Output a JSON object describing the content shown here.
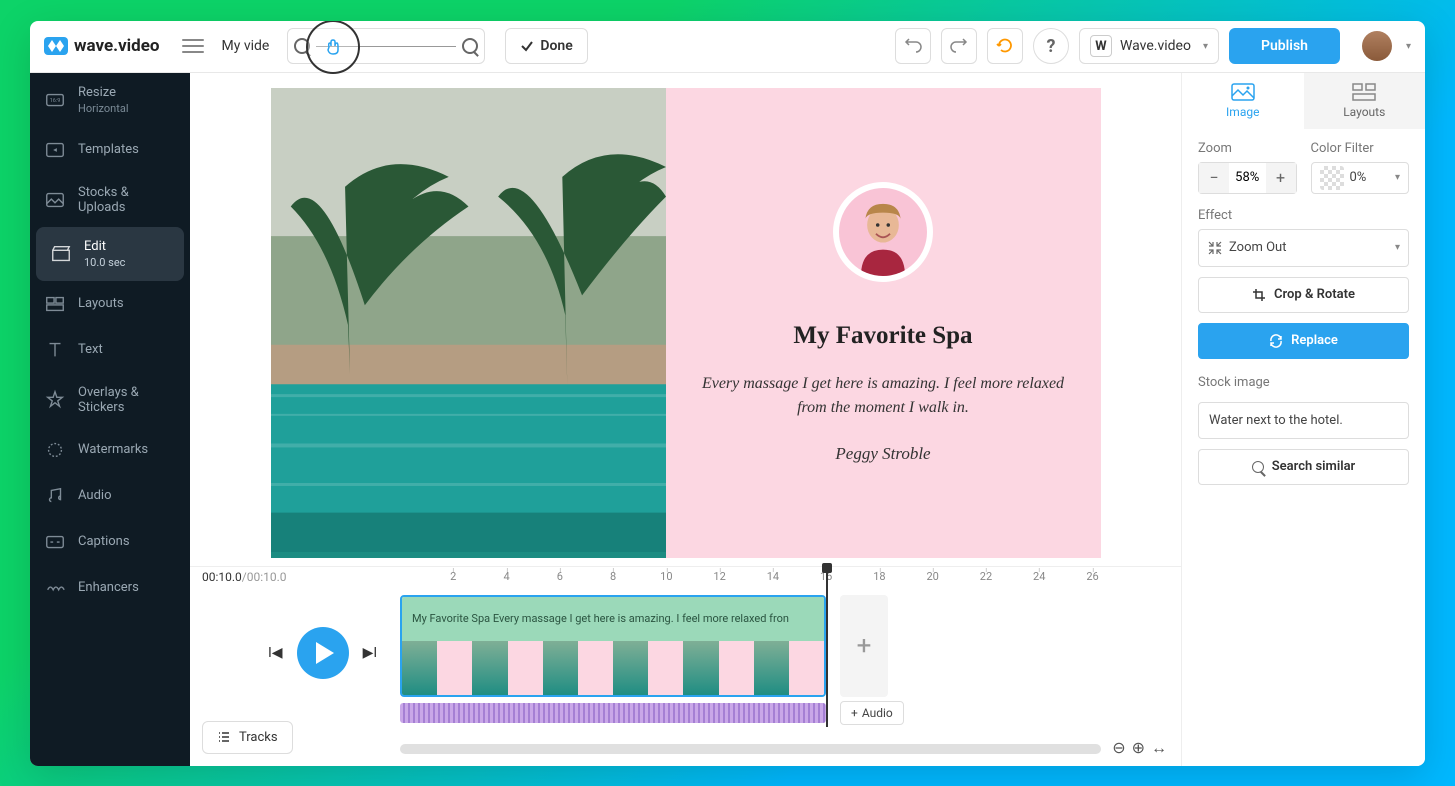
{
  "header": {
    "brand": "wave.video",
    "project_name": "My vide",
    "done_label": "Done",
    "workspace_label": "Wave.video",
    "workspace_badge": "W",
    "publish_label": "Publish"
  },
  "sidebar": {
    "items": [
      {
        "label": "Resize",
        "sub": "Horizontal"
      },
      {
        "label": "Templates",
        "sub": ""
      },
      {
        "label": "Stocks & Uploads",
        "sub": ""
      },
      {
        "label": "Edit",
        "sub": "10.0 sec"
      },
      {
        "label": "Layouts",
        "sub": ""
      },
      {
        "label": "Text",
        "sub": ""
      },
      {
        "label": "Overlays & Stickers",
        "sub": ""
      },
      {
        "label": "Watermarks",
        "sub": ""
      },
      {
        "label": "Audio",
        "sub": ""
      },
      {
        "label": "Captions",
        "sub": ""
      },
      {
        "label": "Enhancers",
        "sub": ""
      }
    ]
  },
  "canvas": {
    "title": "My Favorite Spa",
    "body": "Every massage I get here is amazing. I feel more relaxed from the moment I walk in.",
    "author": "Peggy Stroble"
  },
  "rpanel": {
    "tab_image": "Image",
    "tab_layouts": "Layouts",
    "zoom_label": "Zoom",
    "zoom_value": "58%",
    "colorfilter_label": "Color Filter",
    "colorfilter_value": "0%",
    "effect_label": "Effect",
    "effect_value": "Zoom Out",
    "crop_label": "Crop & Rotate",
    "replace_label": "Replace",
    "stock_label": "Stock image",
    "stock_value": "Water next to the hotel.",
    "search_label": "Search similar"
  },
  "timeline": {
    "current": "00:10.0",
    "total": "/00:10.0",
    "ruler": [
      "2",
      "4",
      "6",
      "8",
      "10",
      "12",
      "14",
      "16",
      "18",
      "20",
      "22",
      "24",
      "26"
    ],
    "clip_text": "My Favorite Spa Every massage I get here is amazing. I feel more relaxed fron",
    "add_audio": "Audio",
    "tracks_label": "Tracks"
  }
}
